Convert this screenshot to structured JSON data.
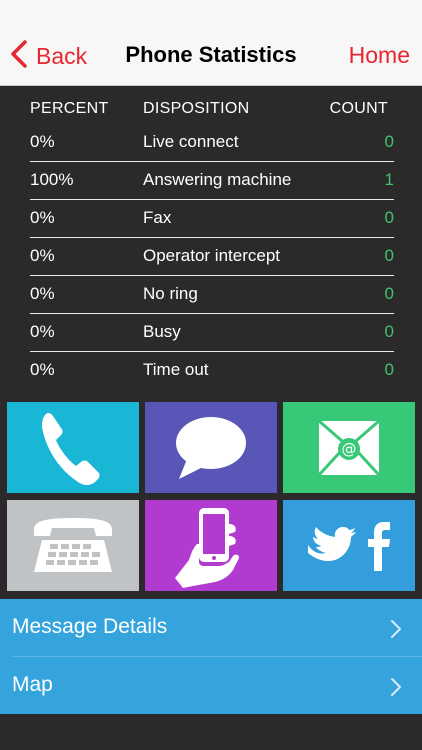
{
  "nav": {
    "back_label": "Back",
    "title": "Phone Statistics",
    "home_label": "Home"
  },
  "stats": {
    "headers": {
      "percent": "PERCENT",
      "disposition": "DISPOSITION",
      "count": "COUNT"
    },
    "rows": [
      {
        "percent": "0%",
        "disposition": "Live connect",
        "count": "0"
      },
      {
        "percent": "100%",
        "disposition": "Answering machine",
        "count": "1"
      },
      {
        "percent": "0%",
        "disposition": "Fax",
        "count": "0"
      },
      {
        "percent": "0%",
        "disposition": "Operator intercept",
        "count": "0"
      },
      {
        "percent": "0%",
        "disposition": "No ring",
        "count": "0"
      },
      {
        "percent": "0%",
        "disposition": "Busy",
        "count": "0"
      },
      {
        "percent": "0%",
        "disposition": "Time out",
        "count": "0"
      }
    ]
  },
  "tiles": [
    {
      "icon": "phone-handset-icon",
      "color": "#19b6d6"
    },
    {
      "icon": "speech-bubble-icon",
      "color": "#5856b7"
    },
    {
      "icon": "email-envelope-icon",
      "color": "#37c878"
    },
    {
      "icon": "desk-phone-icon",
      "color": "#c0c3c6"
    },
    {
      "icon": "hand-smartphone-icon",
      "color": "#b13bd0"
    },
    {
      "icon": "twitter-facebook-icon",
      "color": "#349ddb"
    }
  ],
  "list": {
    "items": [
      {
        "label": "Message Details"
      },
      {
        "label": "Map"
      }
    ]
  },
  "colors": {
    "accent": "#e8262f",
    "count_green": "#3dc46d",
    "background": "#2b2929",
    "list_blue": "#35a4dc"
  }
}
